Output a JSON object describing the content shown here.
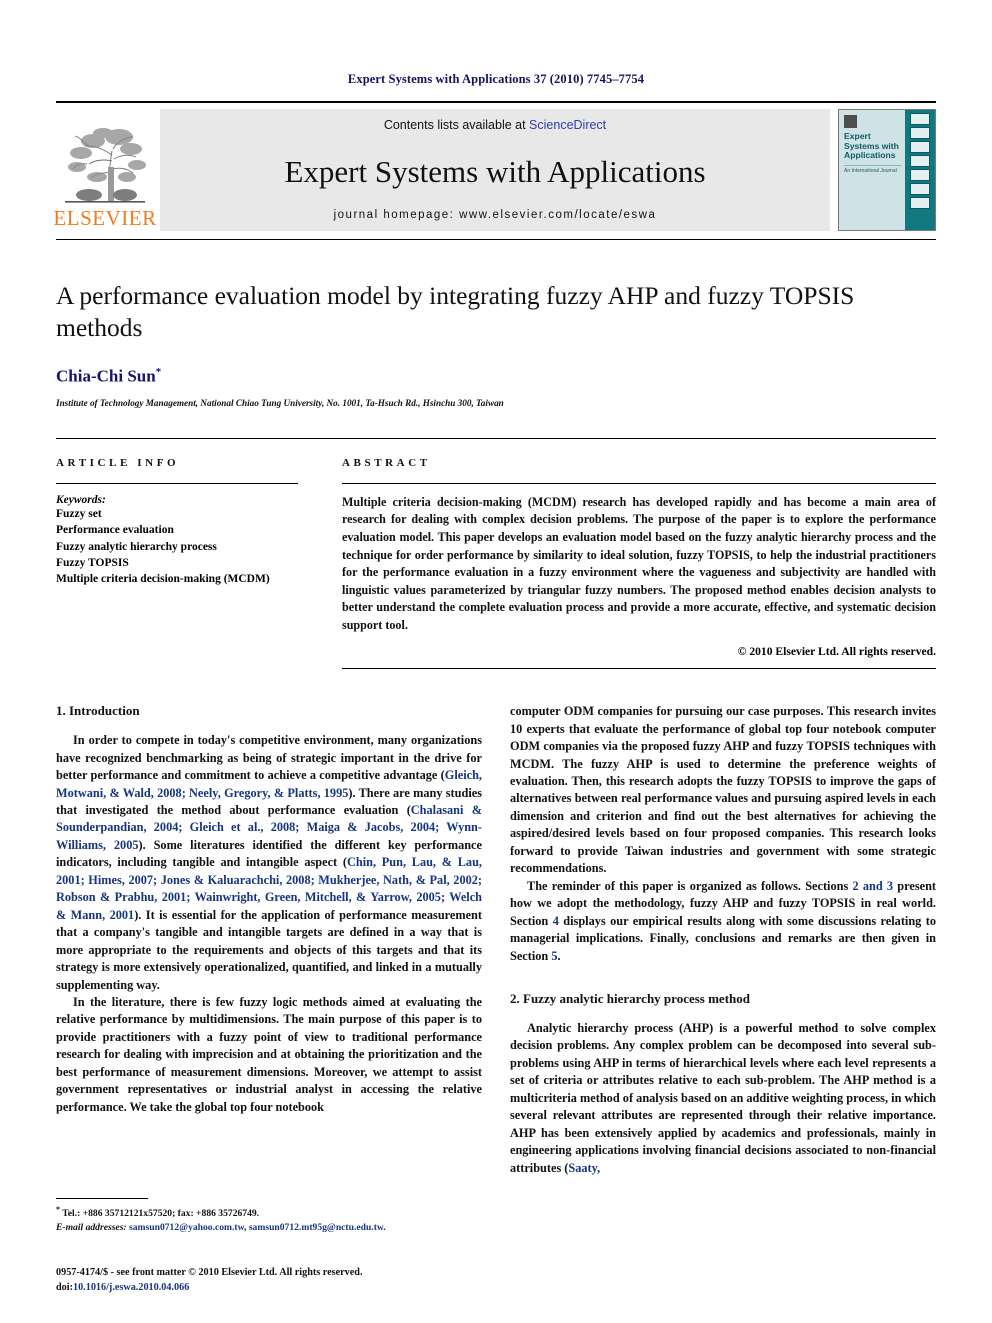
{
  "running_head": "Expert Systems with Applications 37 (2010) 7745–7754",
  "masthead": {
    "publisher_name": "ELSEVIER",
    "contents_prefix": "Contents lists available at ",
    "contents_link": "ScienceDirect",
    "journal_title": "Expert Systems with Applications",
    "homepage": "journal homepage: www.elsevier.com/locate/eswa",
    "cover": {
      "title": "Expert Systems with Applications",
      "subtitle": "An International Journal"
    }
  },
  "article": {
    "title": "A performance evaluation model by integrating fuzzy AHP and fuzzy TOPSIS methods",
    "author": "Chia-Chi Sun",
    "author_marker": "*",
    "affiliation": "Institute of Technology Management, National Chiao Tung University, No. 1001, Ta-Hsuch Rd., Hsinchu 300, Taiwan"
  },
  "article_info": {
    "label": "ARTICLE INFO",
    "keywords_heading": "Keywords:",
    "keywords": [
      "Fuzzy set",
      "Performance evaluation",
      "Fuzzy analytic hierarchy process",
      "Fuzzy TOPSIS",
      "Multiple criteria decision-making (MCDM)"
    ]
  },
  "abstract": {
    "label": "ABSTRACT",
    "text": "Multiple criteria decision-making (MCDM) research has developed rapidly and has become a main area of research for dealing with complex decision problems. The purpose of the paper is to explore the performance evaluation model. This paper develops an evaluation model based on the fuzzy analytic hierarchy process and the technique for order performance by similarity to ideal solution, fuzzy TOPSIS, to help the industrial practitioners for the performance evaluation in a fuzzy environment where the vagueness and subjectivity are handled with linguistic values parameterized by triangular fuzzy numbers. The proposed method enables decision analysts to better understand the complete evaluation process and provide a more accurate, effective, and systematic decision support tool.",
    "copyright": "© 2010 Elsevier Ltd. All rights reserved."
  },
  "sections": {
    "introduction_heading": "1. Introduction",
    "intro_p1_a": "In order to compete in today's competitive environment, many organizations have recognized benchmarking as being of strategic important in the drive for better performance and commitment to achieve a competitive advantage (",
    "intro_p1_cite1": "Gleich, Motwani, & Wald, 2008; Neely, Gregory, & Platts, 1995",
    "intro_p1_b": "). There are many studies that investigated the method about performance evaluation (",
    "intro_p1_cite2": "Chalasani & Sounderpandian, 2004; Gleich et al., 2008; Maiga & Jacobs, 2004; Wynn-Williams, 2005",
    "intro_p1_c": "). Some literatures identified the different key performance indicators, including tangible and intangible aspect (",
    "intro_p1_cite3": "Chin, Pun, Lau, & Lau, 2001; Himes, 2007; Jones & Kaluarachchi, 2008; Mukherjee, Nath, & Pal, 2002; Robson & Prabhu, 2001; Wainwright, Green, Mitchell, & Yarrow, 2005; Welch & Mann, 2001",
    "intro_p1_d": "). It is essential for the application of performance measurement that a company's tangible and intangible targets are defined in a way that is more appropriate to the requirements and objects of this targets and that its strategy is more extensively operationalized, quantified, and linked in a mutually supplementing way.",
    "intro_p2": "In the literature, there is few fuzzy logic methods aimed at evaluating the relative performance by multidimensions. The main purpose of this paper is to provide practitioners with a fuzzy point of view to traditional performance research for dealing with imprecision and at obtaining the prioritization and the best performance of measurement dimensions. Moreover, we attempt to assist government representatives or industrial analyst in accessing the relative performance. We take the global top four notebook",
    "intro_p2_cont": "computer ODM companies for pursuing our case purposes. This research invites 10 experts that evaluate the performance of global top four notebook computer ODM companies via the proposed fuzzy AHP and fuzzy TOPSIS techniques with MCDM. The fuzzy AHP is used to determine the preference weights of evaluation. Then, this research adopts the fuzzy TOPSIS to improve the gaps of alternatives between real performance values and pursuing aspired levels in each dimension and criterion and find out the best alternatives for achieving the aspired/desired levels based on four proposed companies. This research looks forward to provide Taiwan industries and government with some strategic recommendations.",
    "intro_p3_a": "The reminder of this paper is organized as follows. Sections ",
    "intro_p3_ref1": "2 and 3",
    "intro_p3_b": " present how we adopt the methodology, fuzzy AHP and fuzzy TOPSIS in real world. Section ",
    "intro_p3_ref2": "4",
    "intro_p3_c": " displays our empirical results along with some discussions relating to managerial implications. Finally, conclusions and remarks are then given in Section ",
    "intro_p3_ref3": "5",
    "intro_p3_d": ".",
    "fahp_heading": "2. Fuzzy analytic hierarchy process method",
    "fahp_p1_a": "Analytic hierarchy process (AHP) is a powerful method to solve complex decision problems. Any complex problem can be decomposed into several sub-problems using AHP in terms of hierarchical levels where each level represents a set of criteria or attributes relative to each sub-problem. The AHP method is a multicriteria method of analysis based on an additive weighting process, in which several relevant attributes are represented through their relative importance. AHP has been extensively applied by academics and professionals, mainly in engineering applications involving financial decisions associated to non-financial attributes (",
    "fahp_p1_cite": "Saaty,"
  },
  "footnote": {
    "marker": "*",
    "tel": "Tel.: +886 35712121x57520; fax: +886 35726749.",
    "email_label": "E-mail addresses:",
    "email1": "samsun0712@yahoo.com.tw",
    "email_sep": ", ",
    "email2": "samsun0712.mt95g@nctu.edu.tw",
    "email_end": "."
  },
  "colophon": {
    "issn_line": "0957-4174/$ - see front matter © 2010 Elsevier Ltd. All rights reserved.",
    "doi_prefix": "doi:",
    "doi": "10.1016/j.eswa.2010.04.066"
  }
}
